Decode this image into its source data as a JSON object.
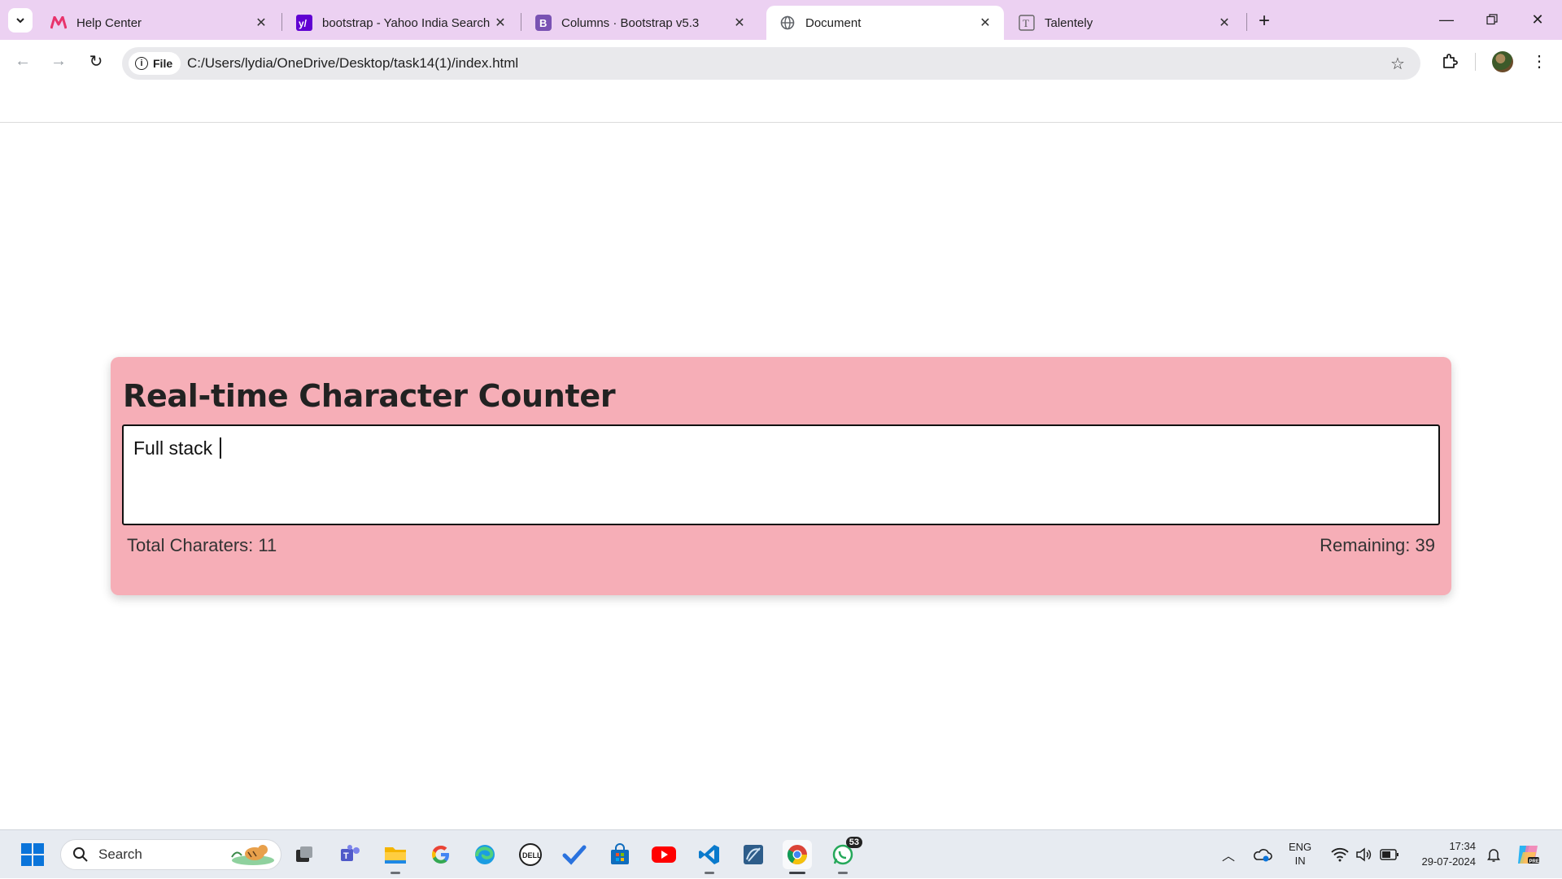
{
  "browser": {
    "tabs": [
      {
        "title": "Help Center",
        "favicon": "myntra-logo-icon"
      },
      {
        "title": "bootstrap - Yahoo India Search",
        "favicon": "yahoo-logo-icon"
      },
      {
        "title": "Columns · Bootstrap v5.3",
        "favicon": "bootstrap-logo-icon"
      },
      {
        "title": "Document",
        "favicon": "globe-icon",
        "active": true
      },
      {
        "title": "Talentely",
        "favicon": "talentely-logo-icon"
      }
    ],
    "address": {
      "chip_label": "File",
      "url": "C:/Users/lydia/OneDrive/Desktop/task14(1)/index.html"
    }
  },
  "page": {
    "heading": "Real-time Character Counter",
    "textarea_value": "Full stack ",
    "total_label": "Total Charaters: 11",
    "remaining_label": "Remaining: 39",
    "card_color": "#f6aeb7"
  },
  "taskbar": {
    "search_placeholder": "Search",
    "whatsapp_badge": "53",
    "language_line1": "ENG",
    "language_line2": "IN",
    "time": "17:34",
    "date": "29-07-2024"
  }
}
